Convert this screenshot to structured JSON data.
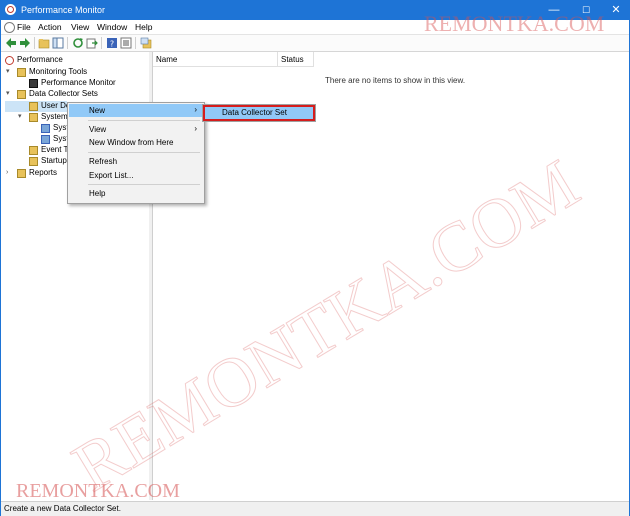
{
  "window": {
    "title": "Performance Monitor",
    "controls": {
      "minimize": "—",
      "maximize": "☐",
      "close": "✕"
    }
  },
  "menubar": {
    "items": [
      "File",
      "Action",
      "View",
      "Window",
      "Help"
    ]
  },
  "toolbar": {
    "icons": [
      "back-icon",
      "forward-icon",
      "up-folder-icon",
      "show-hide-tree-icon",
      "refresh-icon",
      "export-icon",
      "help-icon",
      "properties-icon",
      "new-window-icon"
    ]
  },
  "tree": {
    "items": [
      {
        "label": "Performance"
      },
      {
        "label": "Monitoring Tools"
      },
      {
        "label": "Performance Monitor"
      },
      {
        "label": "Data Collector Sets"
      },
      {
        "label": "User De"
      },
      {
        "label": "System"
      },
      {
        "label": "Syst"
      },
      {
        "label": "Syst"
      },
      {
        "label": "Event T"
      },
      {
        "label": "Startup"
      },
      {
        "label": "Reports"
      }
    ]
  },
  "list": {
    "columns": [
      "Name",
      "Status"
    ],
    "empty_message": "There are no items to show in this view."
  },
  "context_menu": {
    "items": [
      {
        "label": "New",
        "has_submenu": true,
        "highlighted": true
      },
      {
        "label": "View",
        "has_submenu": true
      },
      {
        "label": "New Window from Here"
      },
      {
        "label": "Refresh"
      },
      {
        "label": "Export List..."
      },
      {
        "label": "Help"
      }
    ],
    "submenu_arrow": "›"
  },
  "submenu": {
    "item": "Data Collector Set"
  },
  "status_bar": {
    "text": "Create a new Data Collector Set."
  },
  "watermark": {
    "text": "REMONTKA.COM"
  },
  "colors": {
    "titlebar": "#1e74d6",
    "highlight": "#91c9f7",
    "annotation": "#d51d1d",
    "watermark": "#d65050"
  }
}
